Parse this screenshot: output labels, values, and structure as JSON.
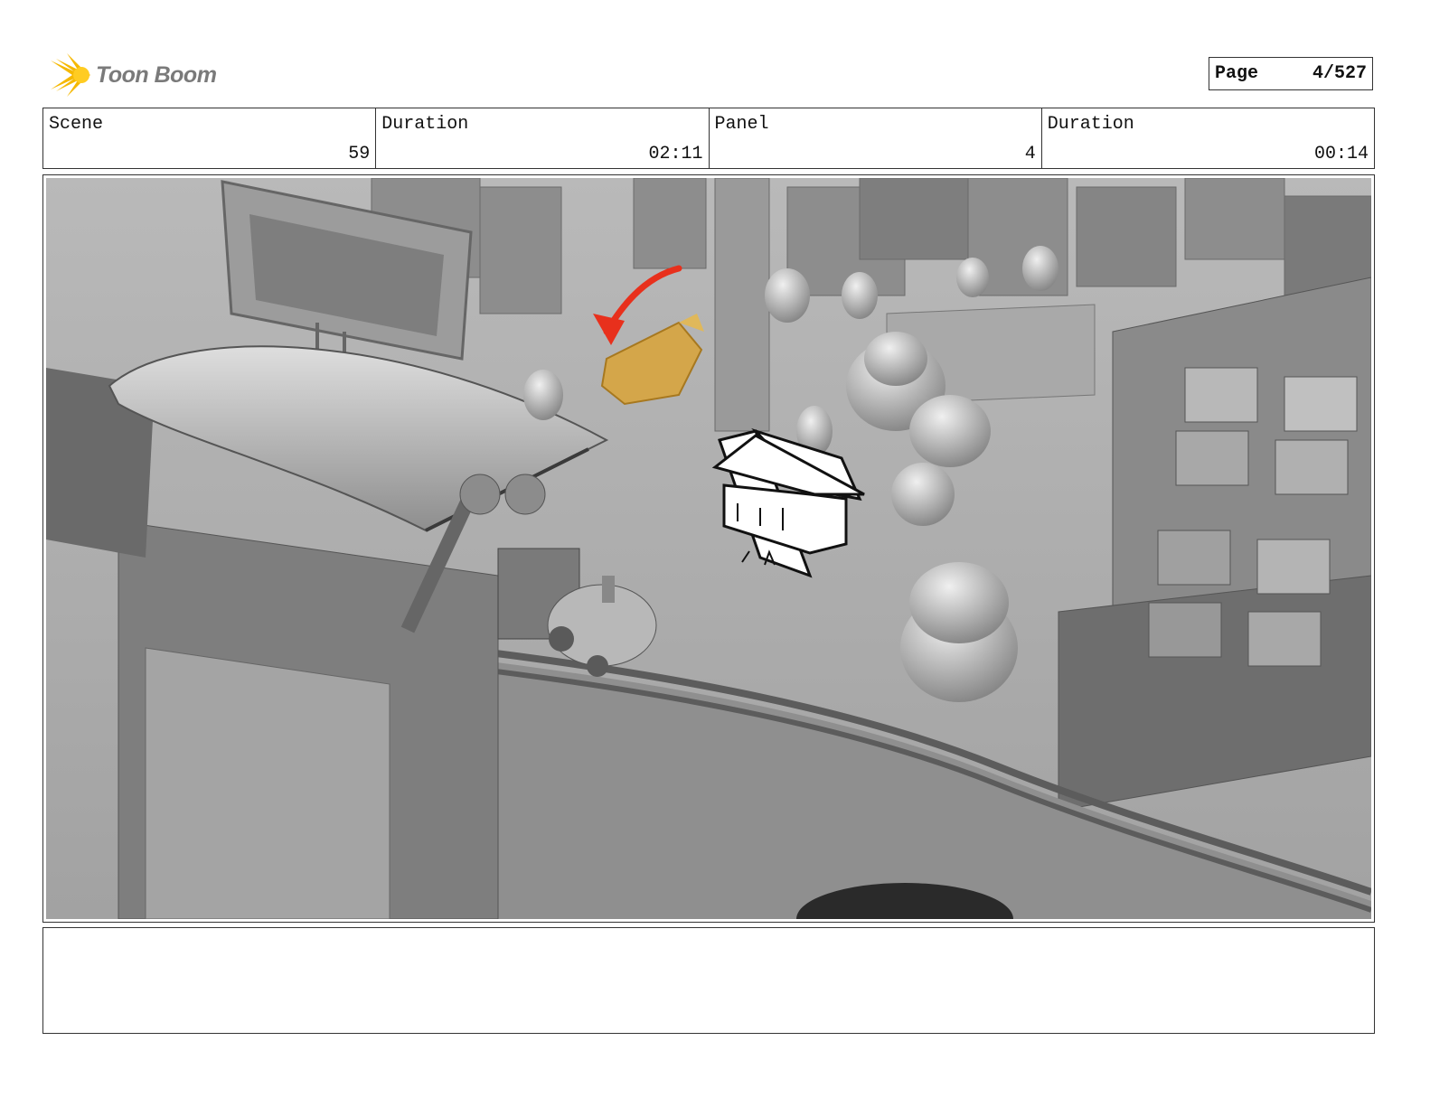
{
  "header": {
    "logo_text": "Toon Boom",
    "page_label": "Page",
    "page_value": "4/527"
  },
  "info": {
    "scene_label": "Scene",
    "scene_value": "59",
    "duration1_label": "Duration",
    "duration1_value": "02:11",
    "panel_label": "Panel",
    "panel_value": "4",
    "duration2_label": "Duration",
    "duration2_value": "00:14"
  },
  "notes": {
    "text": ""
  },
  "colors": {
    "logo_yellow": "#f5b800",
    "arrow_red": "#e8301c",
    "gold_vehicle": "#d4a64a",
    "scene_grey": "#9c9c9c"
  }
}
